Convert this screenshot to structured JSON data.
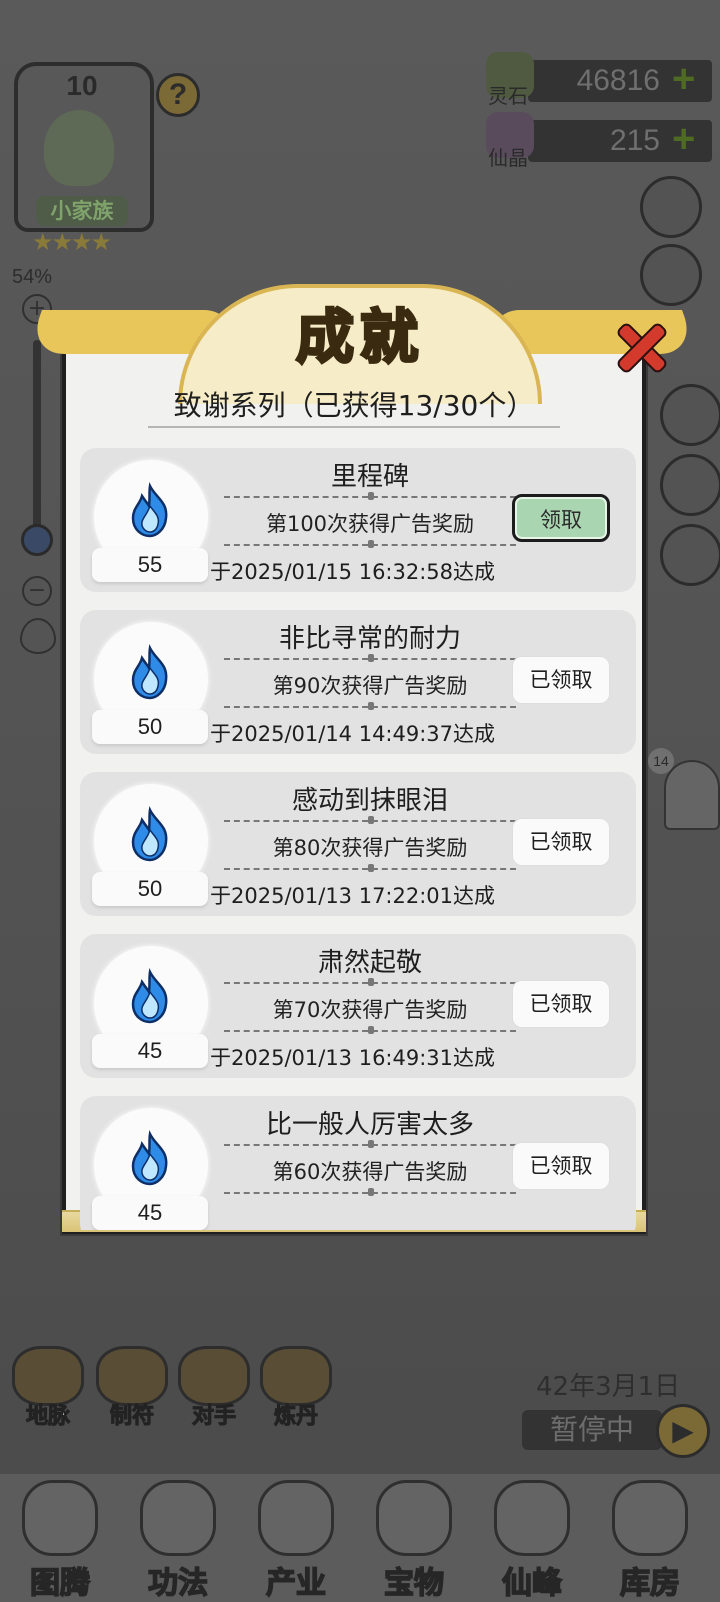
{
  "clan": {
    "level": "10",
    "name": "小家族",
    "stars": "★★★★",
    "help": "?"
  },
  "zoom": {
    "percent": "54%",
    "plus": "+",
    "minus": "−",
    "level": 0.54
  },
  "resources": [
    {
      "label": "灵石",
      "value": "46816",
      "icon": "spirit-stone-icon",
      "plus": "+"
    },
    {
      "label": "仙晶",
      "value": "215",
      "icon": "immortal-crystal-icon",
      "plus": "+"
    }
  ],
  "game_clock": {
    "date": "42年3月1日",
    "status": "暂停中",
    "play": "▶"
  },
  "utility_buttons": [
    {
      "label": "地脉",
      "icon": "dragon-icon"
    },
    {
      "label": "制符",
      "icon": "talisman-icon"
    },
    {
      "label": "对手",
      "icon": "gate-icon"
    },
    {
      "label": "炼丹",
      "icon": "cauldron-icon"
    }
  ],
  "bottom_nav": [
    {
      "label": "图腾",
      "icon": "totem-icon"
    },
    {
      "label": "功法",
      "icon": "technique-icon"
    },
    {
      "label": "产业",
      "icon": "industry-icon"
    },
    {
      "label": "宝物",
      "icon": "treasure-icon"
    },
    {
      "label": "仙峰",
      "icon": "peak-icon"
    },
    {
      "label": "库房",
      "icon": "warehouse-icon"
    }
  ],
  "npc": {
    "level": "14"
  },
  "modal": {
    "title": "成就",
    "series": "致谢系列（已获得13/30个）",
    "achievements": [
      {
        "name": "里程碑",
        "condition": "第100次获得广告奖励",
        "reward": "55",
        "date": "于2025/01/15 16:32:58达成",
        "button": "领取",
        "claimed": false
      },
      {
        "name": "非比寻常的耐力",
        "condition": "第90次获得广告奖励",
        "reward": "50",
        "date": "于2025/01/14 14:49:37达成",
        "button": "已领取",
        "claimed": true
      },
      {
        "name": "感动到抹眼泪",
        "condition": "第80次获得广告奖励",
        "reward": "50",
        "date": "于2025/01/13 17:22:01达成",
        "button": "已领取",
        "claimed": true
      },
      {
        "name": "肃然起敬",
        "condition": "第70次获得广告奖励",
        "reward": "45",
        "date": "于2025/01/13 16:49:31达成",
        "button": "已领取",
        "claimed": true
      },
      {
        "name": "比一般人厉害太多",
        "condition": "第60次获得广告奖励",
        "reward": "45",
        "date": "",
        "button": "已领取",
        "claimed": true
      }
    ]
  },
  "colors": {
    "claim_active": "#a9d6b0",
    "title_gold": "#e3b43a",
    "close_red": "#d43a2c",
    "flame_blue": "#2f8be8"
  }
}
